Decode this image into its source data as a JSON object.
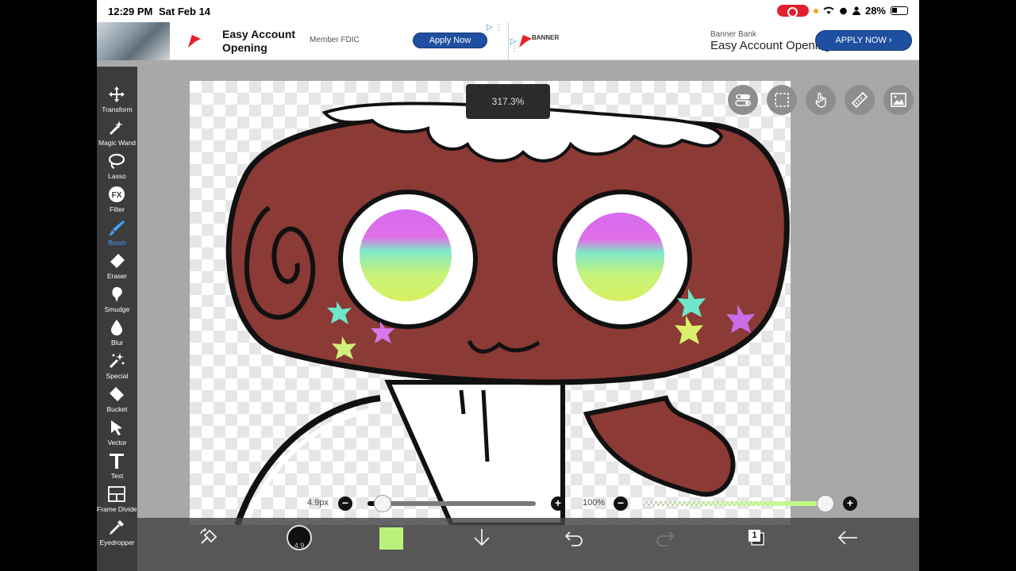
{
  "status_bar": {
    "time": "12:29 PM",
    "date": "Sat Feb 14",
    "battery": "28%"
  },
  "ad": {
    "title": "Easy Account Opening",
    "fdic": "Member FDIC",
    "apply_small": "Apply Now",
    "banner_logo": "BANNER",
    "bank_name": "Banner Bank",
    "bank_headline": "Easy Account Opening",
    "apply_big": "APPLY NOW"
  },
  "toolbar": {
    "tools": [
      {
        "label": "Transform",
        "icon": "move-icon"
      },
      {
        "label": "Magic Wand",
        "icon": "magic-wand-icon"
      },
      {
        "label": "Lasso",
        "icon": "lasso-icon"
      },
      {
        "label": "Filter",
        "icon": "fx-icon"
      },
      {
        "label": "Brush",
        "icon": "brush-icon"
      },
      {
        "label": "Eraser",
        "icon": "eraser-icon"
      },
      {
        "label": "Smudge",
        "icon": "smudge-icon"
      },
      {
        "label": "Blur",
        "icon": "drop-icon"
      },
      {
        "label": "Special",
        "icon": "special-icon"
      },
      {
        "label": "Bucket",
        "icon": "bucket-icon"
      },
      {
        "label": "Vector",
        "icon": "vector-icon"
      },
      {
        "label": "Text",
        "icon": "text-icon"
      },
      {
        "label": "Frame Divider",
        "icon": "frame-divider-icon"
      },
      {
        "label": "Eyedropper",
        "icon": "eyedropper-icon"
      }
    ],
    "active": "Brush"
  },
  "canvas": {
    "zoom": "317.3%"
  },
  "brush": {
    "size_label": "4.9px",
    "size_fraction": 0.09,
    "opacity_label": "100%",
    "opacity_fraction": 1.0,
    "preview_size": "4.9"
  },
  "bottom_bar": {
    "color": "#b9f27a",
    "layer_count": "1"
  },
  "colors": {
    "active_tool": "#3ea4ff",
    "ad_button": "#1f4fa0",
    "cookie_brown": "#8b3a35"
  }
}
